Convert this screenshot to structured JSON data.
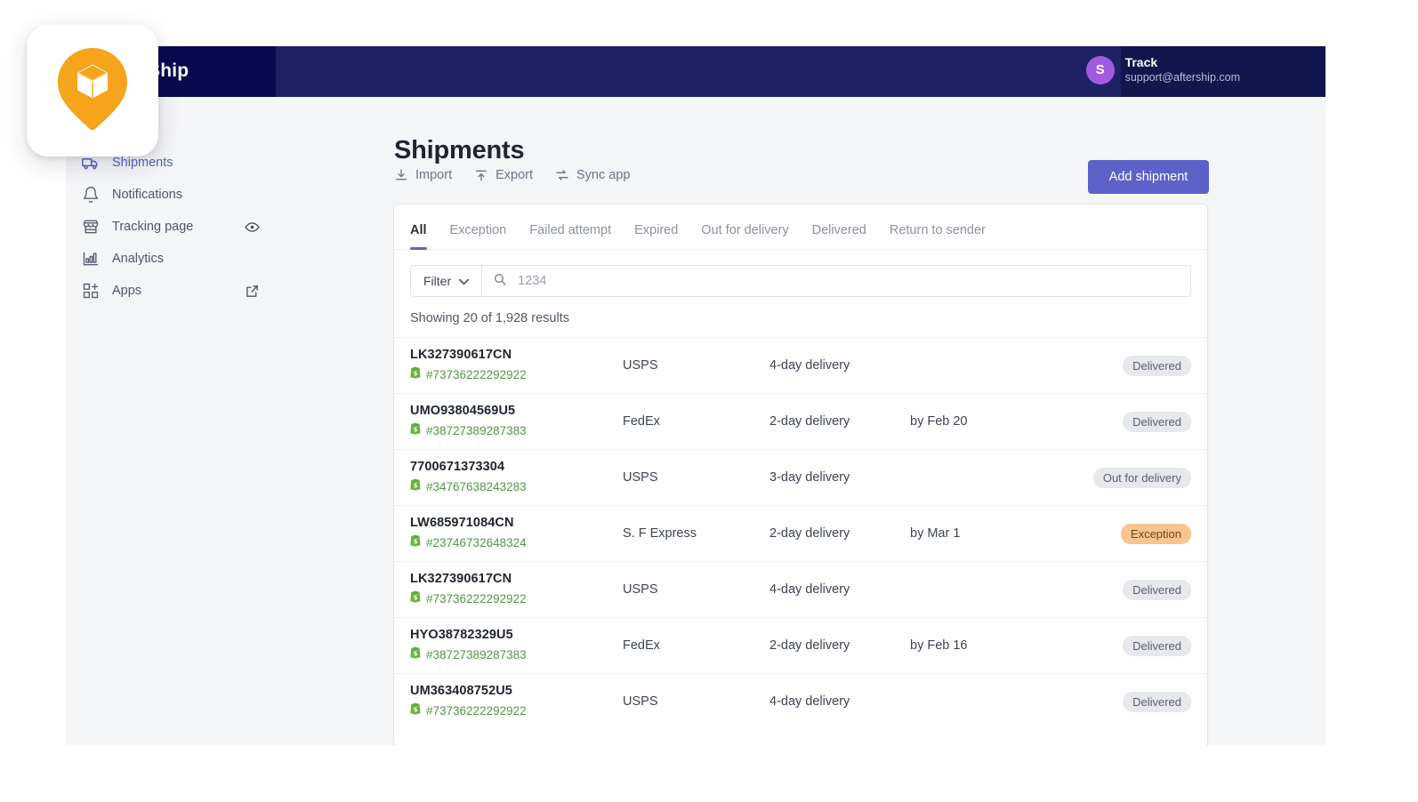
{
  "topbar": {
    "brand": "AfterShip",
    "brand_visible_fragment": "hip",
    "user": {
      "avatar_initial": "S",
      "name": "Track",
      "email": "support@aftership.com",
      "avatar_color": "#a05ce0"
    }
  },
  "sidebar": {
    "items": [
      {
        "label": "Shipments",
        "icon": "truck-icon",
        "active": true,
        "trailing_icon": ""
      },
      {
        "label": "Notifications",
        "icon": "bell-icon",
        "active": false,
        "trailing_icon": ""
      },
      {
        "label": "Tracking page",
        "icon": "storefront-icon",
        "active": false,
        "trailing_icon": "eye-icon"
      },
      {
        "label": "Analytics",
        "icon": "bar-chart-icon",
        "active": false,
        "trailing_icon": ""
      },
      {
        "label": "Apps",
        "icon": "apps-add-icon",
        "active": false,
        "trailing_icon": "external-link-icon"
      }
    ]
  },
  "page": {
    "title": "Shipments",
    "actions": [
      {
        "label": "Import",
        "icon": "download-icon"
      },
      {
        "label": "Export",
        "icon": "upload-icon"
      },
      {
        "label": "Sync app",
        "icon": "sync-icon"
      }
    ],
    "primary_button": "Add shipment",
    "primary_button_color": "#5c62c8"
  },
  "tabs": [
    {
      "label": "All",
      "active": true
    },
    {
      "label": "Exception",
      "active": false
    },
    {
      "label": "Failed attempt",
      "active": false
    },
    {
      "label": "Expired",
      "active": false
    },
    {
      "label": "Out for delivery",
      "active": false
    },
    {
      "label": "Delivered",
      "active": false
    },
    {
      "label": "Return to sender",
      "active": false
    }
  ],
  "toolbar": {
    "filter_label": "Filter",
    "search_value": "1234",
    "search_placeholder": "1234",
    "search_icon": "search-icon",
    "caret_icon": "chevron-down-icon"
  },
  "results_summary": "Showing 20 of 1,928 results",
  "shipments": [
    {
      "tracking_number": "LK327390617CN",
      "order_number": "#73736222292922",
      "store_icon": "shopify-bag-icon",
      "carrier": "USPS",
      "delivery_speed": "4-day delivery",
      "eta": "",
      "status": "Delivered",
      "status_style": "grey"
    },
    {
      "tracking_number": "UMO93804569U5",
      "order_number": "#38727389287383",
      "store_icon": "shopify-bag-icon",
      "carrier": "FedEx",
      "delivery_speed": "2-day delivery",
      "eta": "by Feb 20",
      "status": "Delivered",
      "status_style": "grey"
    },
    {
      "tracking_number": "7700671373304",
      "order_number": "#34767638243283",
      "store_icon": "shopify-bag-icon",
      "carrier": "USPS",
      "delivery_speed": "3-day delivery",
      "eta": "",
      "status": "Out for delivery",
      "status_style": "grey"
    },
    {
      "tracking_number": "LW685971084CN",
      "order_number": "#23746732648324",
      "store_icon": "shopify-bag-icon",
      "carrier": "S. F Express",
      "delivery_speed": "2-day delivery",
      "eta": "by Mar 1",
      "status": "Exception",
      "status_style": "orange"
    },
    {
      "tracking_number": "LK327390617CN",
      "order_number": "#73736222292922",
      "store_icon": "shopify-bag-icon",
      "carrier": "USPS",
      "delivery_speed": "4-day delivery",
      "eta": "",
      "status": "Delivered",
      "status_style": "grey"
    },
    {
      "tracking_number": "HYO38782329U5",
      "order_number": "#38727389287383",
      "store_icon": "shopify-bag-icon",
      "carrier": "FedEx",
      "delivery_speed": "2-day delivery",
      "eta": "by Feb 16",
      "status": "Delivered",
      "status_style": "grey"
    },
    {
      "tracking_number": "UM363408752U5",
      "order_number": "#73736222292922",
      "store_icon": "shopify-bag-icon",
      "carrier": "USPS",
      "delivery_speed": "4-day delivery",
      "eta": "",
      "status": "Delivered",
      "status_style": "grey"
    }
  ],
  "logo_overlay": {
    "icon": "aftership-pin-box-logo",
    "color": "#f5a41b"
  }
}
